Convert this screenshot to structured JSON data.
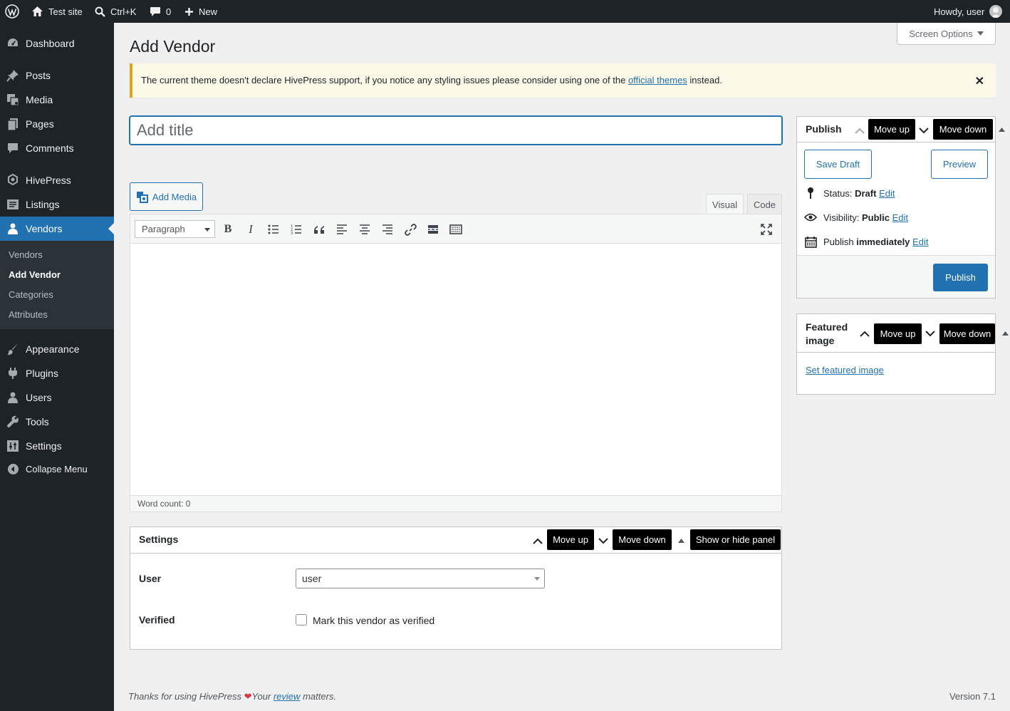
{
  "admin_bar": {
    "site_name": "Test site",
    "search_shortcut": "Ctrl+K",
    "comments_count": "0",
    "new_label": "New",
    "greeting": "Howdy, user"
  },
  "sidebar": {
    "items": [
      {
        "label": "Dashboard",
        "icon": "dashboard-icon"
      },
      {
        "label": "Posts",
        "icon": "pushpin-icon"
      },
      {
        "label": "Media",
        "icon": "media-icon"
      },
      {
        "label": "Pages",
        "icon": "pages-icon"
      },
      {
        "label": "Comments",
        "icon": "comment-icon"
      },
      {
        "label": "HivePress",
        "icon": "hivepress-icon"
      },
      {
        "label": "Listings",
        "icon": "listings-icon"
      },
      {
        "label": "Vendors",
        "icon": "vendor-icon"
      },
      {
        "label": "Appearance",
        "icon": "brush-icon"
      },
      {
        "label": "Plugins",
        "icon": "plugin-icon"
      },
      {
        "label": "Users",
        "icon": "users-icon"
      },
      {
        "label": "Tools",
        "icon": "wrench-icon"
      },
      {
        "label": "Settings",
        "icon": "settings-icon"
      },
      {
        "label": "Collapse Menu",
        "icon": "collapse-icon"
      }
    ],
    "submenu": [
      "Vendors",
      "Add Vendor",
      "Categories",
      "Attributes"
    ]
  },
  "page": {
    "title": "Add Vendor",
    "screen_options": "Screen Options"
  },
  "notice": {
    "text_before": "The current theme doesn't declare HivePress support, if you notice any styling issues please consider using one of the",
    "link": "official themes",
    "text_after": "instead.",
    "dismiss": "✕"
  },
  "editor": {
    "title_placeholder": "Add title",
    "add_media": "Add Media",
    "tab_visual": "Visual",
    "tab_code": "Code",
    "format": "Paragraph",
    "word_count": "Word count: 0"
  },
  "publish_box": {
    "title": "Publish",
    "move_up": "Move up",
    "move_down": "Move down",
    "save_draft": "Save Draft",
    "preview": "Preview",
    "status_label": "Status:",
    "status_value": "Draft",
    "visibility_label": "Visibility:",
    "visibility_value": "Public",
    "publish_label": "Publish",
    "publish_value": "immediately",
    "edit": "Edit",
    "publish_button": "Publish"
  },
  "featured_box": {
    "title_line1": "Featured",
    "title_line2": "image",
    "move_up": "Move up",
    "move_down": "Move down",
    "set_link": "Set featured image"
  },
  "settings_box": {
    "title": "Settings",
    "move_up": "Move up",
    "move_down": "Move down",
    "toggle": "Show or hide panel",
    "user_label": "User",
    "user_value": "user",
    "verified_label": "Verified",
    "verified_text": "Mark this vendor as verified"
  },
  "footer": {
    "text_before": "Thanks for using HivePress",
    "text_mid": "Your",
    "link": "review",
    "text_after": "matters.",
    "version": "Version 7.1"
  },
  "colors": {
    "accent": "#2271b1",
    "admin_dark": "#1d2327",
    "notice_border": "#dba617",
    "heart": "#d63638"
  }
}
